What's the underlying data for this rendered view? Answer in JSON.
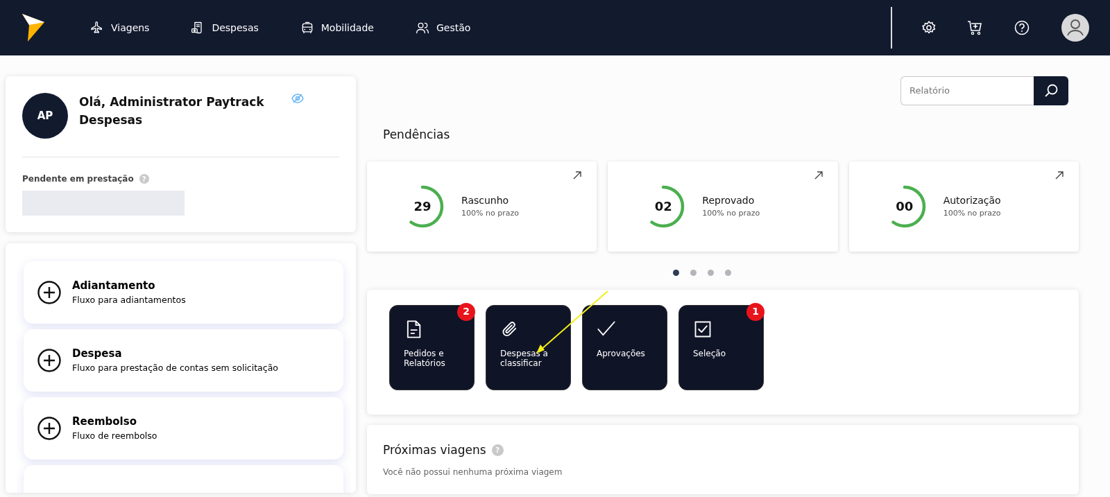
{
  "nav": {
    "items": [
      {
        "label": "Viagens",
        "kind": "plane"
      },
      {
        "label": "Despesas",
        "kind": "receipt"
      },
      {
        "label": "Mobilidade",
        "kind": "car"
      },
      {
        "label": "Gestão",
        "kind": "users"
      }
    ]
  },
  "profile": {
    "initials": "AP",
    "greeting": "Olá, Administrator Paytrack Despesas",
    "pending_label": "Pendente em prestação",
    "help": "?"
  },
  "flows": [
    {
      "title": "Adiantamento",
      "description": "Fluxo para adiantamentos"
    },
    {
      "title": "Despesa",
      "description": "Fluxo para prestação de contas sem solicitação"
    },
    {
      "title": "Reembolso",
      "description": "Fluxo de reembolso"
    }
  ],
  "search": {
    "placeholder": "Relatório"
  },
  "pendencias": {
    "title": "Pendências",
    "cards": [
      {
        "count": "29",
        "label": "Rascunho",
        "sub": "100% no prazo"
      },
      {
        "count": "02",
        "label": "Reprovado",
        "sub": "100% no prazo"
      },
      {
        "count": "00",
        "label": "Autorização",
        "sub": "100% no prazo"
      }
    ],
    "dots": [
      {
        "selected": true
      },
      {
        "selected": false
      },
      {
        "selected": false
      },
      {
        "selected": false
      }
    ]
  },
  "shortcuts": [
    {
      "label": "Pedidos e Relatórios",
      "kind": "document",
      "badge": "2"
    },
    {
      "label": "Despesas a classificar",
      "kind": "clip"
    },
    {
      "label": "Aprovações",
      "kind": "check"
    },
    {
      "label": "Seleção",
      "kind": "checkbox",
      "badge": "1"
    }
  ],
  "trips": {
    "title": "Próximas viagens",
    "help": "?",
    "empty": "Você não possui nenhuma próxima viagem"
  }
}
